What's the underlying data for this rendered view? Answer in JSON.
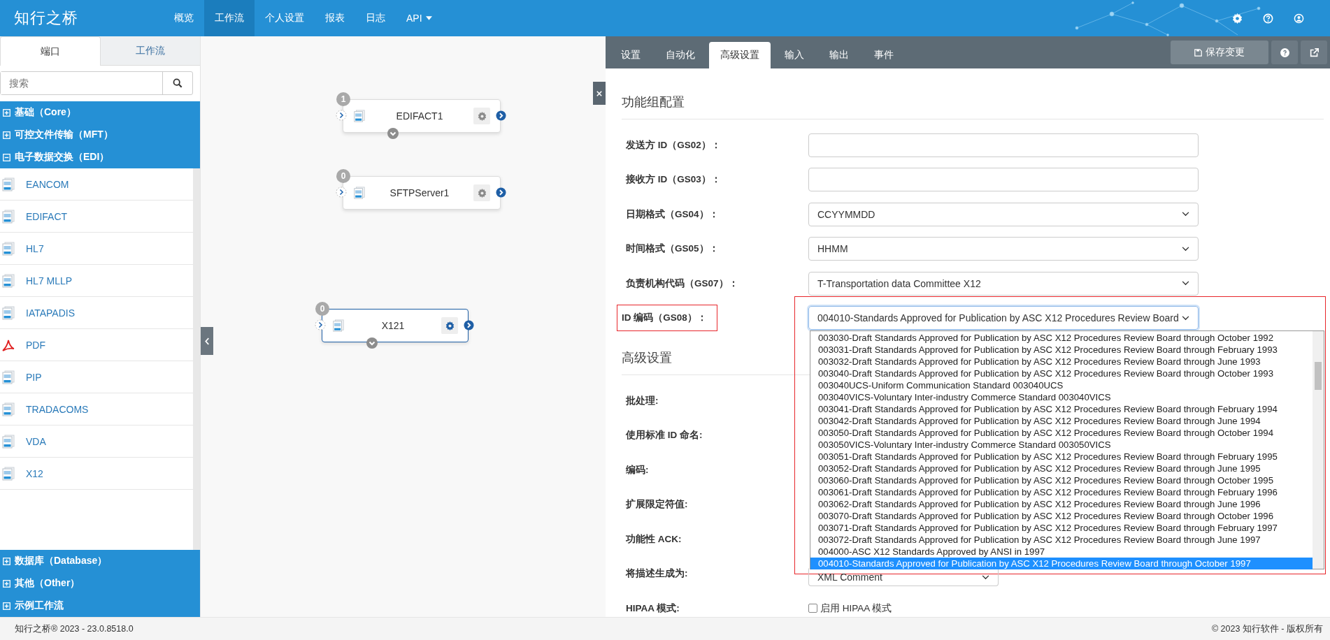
{
  "brand": {
    "name": "知行之桥"
  },
  "nav": [
    {
      "label": "概览",
      "selected": false,
      "kind": "link"
    },
    {
      "label": "工作流",
      "selected": true,
      "kind": "link"
    },
    {
      "label": "个人设置",
      "selected": false,
      "kind": "link"
    },
    {
      "label": "报表",
      "selected": false,
      "kind": "link"
    },
    {
      "label": "日志",
      "selected": false,
      "kind": "link"
    },
    {
      "label": "API",
      "selected": false,
      "kind": "dropdown"
    }
  ],
  "left_panel": {
    "tabs": [
      {
        "label": "端口",
        "selected": true
      },
      {
        "label": "工作流",
        "selected": false
      }
    ],
    "search": {
      "placeholder": "搜索"
    },
    "categories": [
      {
        "label": "基础（Core）",
        "expanded": false
      },
      {
        "label": "可控文件传输（MFT）",
        "expanded": false
      },
      {
        "label": "电子数据交换（EDI）",
        "expanded": true,
        "children": [
          {
            "label": "EANCOM",
            "kind": "doc"
          },
          {
            "label": "EDIFACT",
            "kind": "doc"
          },
          {
            "label": "HL7",
            "kind": "doc"
          },
          {
            "label": "HL7 MLLP",
            "kind": "doc"
          },
          {
            "label": "IATAPADIS",
            "kind": "doc"
          },
          {
            "label": "PDF",
            "kind": "pdf"
          },
          {
            "label": "PIP",
            "kind": "doc"
          },
          {
            "label": "TRADACOMS",
            "kind": "doc"
          },
          {
            "label": "VDA",
            "kind": "doc"
          },
          {
            "label": "X12",
            "kind": "doc"
          }
        ]
      },
      {
        "label": "数据库（Database）",
        "expanded": false
      },
      {
        "label": "其他（Other）",
        "expanded": false
      },
      {
        "label": "示例工作流",
        "expanded": false
      }
    ]
  },
  "canvas": {
    "nodes": [
      {
        "label": "EDIFACT1",
        "count": "1",
        "selected": false,
        "expander": true
      },
      {
        "label": "SFTPServer1",
        "count": "0",
        "selected": false,
        "expander": false
      },
      {
        "label": "X121",
        "count": "0",
        "selected": true,
        "expander": true
      }
    ]
  },
  "right_panel": {
    "tabs": [
      {
        "label": "设置",
        "selected": false
      },
      {
        "label": "自动化",
        "selected": false
      },
      {
        "label": "高级设置",
        "selected": true
      },
      {
        "label": "输入",
        "selected": false
      },
      {
        "label": "输出",
        "selected": false
      },
      {
        "label": "事件",
        "selected": false
      }
    ],
    "save_button": "保存变更",
    "sections": [
      {
        "title": "功能组配置",
        "rows": [
          {
            "label": "发送方 ID（GS02）：",
            "kind": "text",
            "highlighted": false
          },
          {
            "label": "接收方 ID（GS03）：",
            "kind": "text",
            "highlighted": false
          },
          {
            "label": "日期格式（GS04）：",
            "kind": "select",
            "value": "CCYYMMDD",
            "highlighted": false
          },
          {
            "label": "时间格式（GS05）：",
            "kind": "select",
            "value": "HHMM",
            "highlighted": false
          },
          {
            "label": "负责机构代码（GS07）：",
            "kind": "select",
            "value": "T-Transportation data Committee X12",
            "highlighted": false
          },
          {
            "label": "ID 编码（GS08）：",
            "kind": "select",
            "value": "004010-Standards Approved for Publication by ASC X12 Procedures Review Board",
            "highlighted": true,
            "open": true,
            "options": [
              {
                "label": "003030-Draft Standards Approved for Publication by ASC X12 Procedures Review Board through October 1992",
                "selected": false
              },
              {
                "label": "003031-Draft Standards Approved for Publication by ASC X12 Procedures Review Board through February 1993",
                "selected": false
              },
              {
                "label": "003032-Draft Standards Approved for Publication by ASC X12 Procedures Review Board through June 1993",
                "selected": false
              },
              {
                "label": "003040-Draft Standards Approved for Publication by ASC X12 Procedures Review Board through October 1993",
                "selected": false
              },
              {
                "label": "003040UCS-Uniform Communication Standard 003040UCS",
                "selected": false
              },
              {
                "label": "003040VICS-Voluntary Inter-industry Commerce Standard 003040VICS",
                "selected": false
              },
              {
                "label": "003041-Draft Standards Approved for Publication by ASC X12 Procedures Review Board through February 1994",
                "selected": false
              },
              {
                "label": "003042-Draft Standards Approved for Publication by ASC X12 Procedures Review Board through June 1994",
                "selected": false
              },
              {
                "label": "003050-Draft Standards Approved for Publication by ASC X12 Procedures Review Board through October 1994",
                "selected": false
              },
              {
                "label": "003050VICS-Voluntary Inter-industry Commerce Standard 003050VICS",
                "selected": false
              },
              {
                "label": "003051-Draft Standards Approved for Publication by ASC X12 Procedures Review Board through February 1995",
                "selected": false
              },
              {
                "label": "003052-Draft Standards Approved for Publication by ASC X12 Procedures Review Board through June 1995",
                "selected": false
              },
              {
                "label": "003060-Draft Standards Approved for Publication by ASC X12 Procedures Review Board through October 1995",
                "selected": false
              },
              {
                "label": "003061-Draft Standards Approved for Publication by ASC X12 Procedures Review Board through February 1996",
                "selected": false
              },
              {
                "label": "003062-Draft Standards Approved for Publication by ASC X12 Procedures Review Board through June 1996",
                "selected": false
              },
              {
                "label": "003070-Draft Standards Approved for Publication by ASC X12 Procedures Review Board through October 1996",
                "selected": false
              },
              {
                "label": "003071-Draft Standards Approved for Publication by ASC X12 Procedures Review Board through February 1997",
                "selected": false
              },
              {
                "label": "003072-Draft Standards Approved for Publication by ASC X12 Procedures Review Board through June 1997",
                "selected": false
              },
              {
                "label": "004000-ASC X12 Standards Approved by ANSI in 1997",
                "selected": false
              },
              {
                "label": "004010-Standards Approved for Publication by ASC X12 Procedures Review Board through October 1997",
                "selected": true
              }
            ]
          }
        ]
      },
      {
        "title": "高级设置",
        "rows": [
          {
            "label": "批处理:",
            "kind": "none",
            "highlighted": false
          },
          {
            "label": "使用标准 ID 命名:",
            "kind": "none",
            "highlighted": false
          },
          {
            "label": "编码:",
            "kind": "none",
            "highlighted": false
          },
          {
            "label": "扩展限定符值:",
            "kind": "none",
            "highlighted": false
          },
          {
            "label": "功能性 ACK:",
            "kind": "none",
            "highlighted": false
          },
          {
            "label": "将描述生成为:",
            "kind": "select",
            "value": "XML Comment",
            "highlighted": false
          },
          {
            "label": "HIPAA 模式:",
            "kind": "checkbox",
            "checked": false,
            "caption": "启用 HIPAA 模式",
            "highlighted": false
          }
        ]
      }
    ]
  },
  "footer": {
    "version": "知行之桥® 2023 - 23.0.8518.0",
    "copyright": "© 2023 知行软件 - 版权所有"
  }
}
